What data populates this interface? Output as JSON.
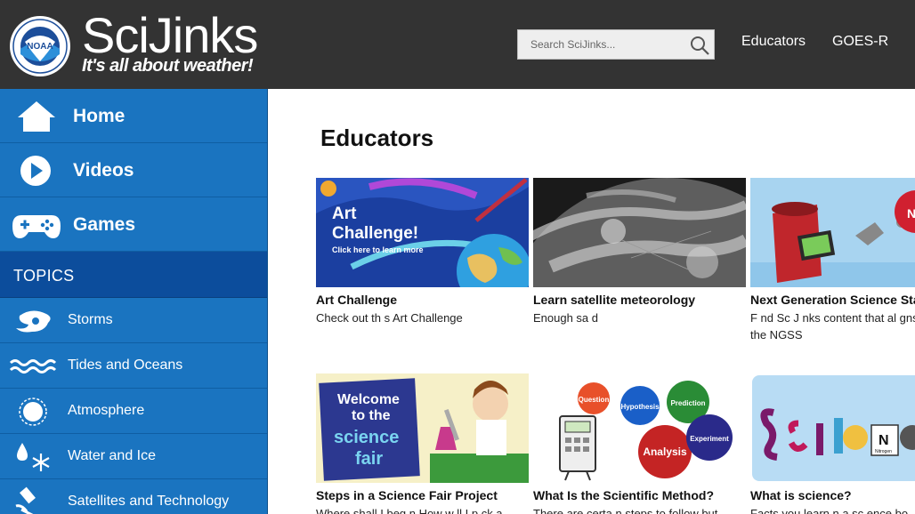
{
  "header": {
    "brand_title": "SciJinks",
    "brand_tagline": "It's all about weather!",
    "seal_text": "NOAA",
    "search_placeholder": "Search SciJinks...",
    "nav": [
      "Educators",
      "GOES-R"
    ]
  },
  "sidebar": {
    "main_items": [
      {
        "label": "Home",
        "icon": "home-icon"
      },
      {
        "label": "Videos",
        "icon": "play-icon"
      },
      {
        "label": "Games",
        "icon": "gamepad-icon"
      }
    ],
    "topics_heading": "TOPICS",
    "topic_items": [
      {
        "label": "Storms",
        "icon": "hurricane-icon"
      },
      {
        "label": "Tides and Oceans",
        "icon": "waves-icon"
      },
      {
        "label": "Atmosphere",
        "icon": "atmosphere-icon"
      },
      {
        "label": "Water and Ice",
        "icon": "water-ice-icon"
      },
      {
        "label": "Satellites and Technology",
        "icon": "satellite-icon"
      }
    ]
  },
  "main": {
    "title": "Educators",
    "cards": [
      {
        "title": "Art Challenge",
        "desc": "Check out th s Art Challenge",
        "thumb_text": [
          "Art",
          "Challenge!",
          "Click here to learn more"
        ]
      },
      {
        "title": "Learn satellite meteorology",
        "desc": "Enough sa d"
      },
      {
        "title": "Next Generation Science Sta",
        "desc": "F nd Sc J nks content that al gns the NGSS"
      },
      {
        "title": "Steps in a Science Fair Project",
        "desc": "Where shall I beg n   How w ll I p ck a",
        "thumb_text": [
          "Welcome",
          "to the",
          "science",
          "fair"
        ]
      },
      {
        "title": "What Is the Scientific Method?",
        "desc": "There are certa n steps to follow  but",
        "thumb_text": [
          "Question",
          "Hypothesis",
          "Prediction",
          "Analysis",
          "Experiment"
        ]
      },
      {
        "title": "What is science?",
        "desc": "Facts you learn  n a sc ence bo",
        "thumb_text": [
          "N",
          "Nitrogen"
        ]
      }
    ]
  },
  "colors": {
    "header_bg": "#333333",
    "sidebar_bg": "#1a74c0",
    "topics_bg": "#0c4d9c"
  }
}
